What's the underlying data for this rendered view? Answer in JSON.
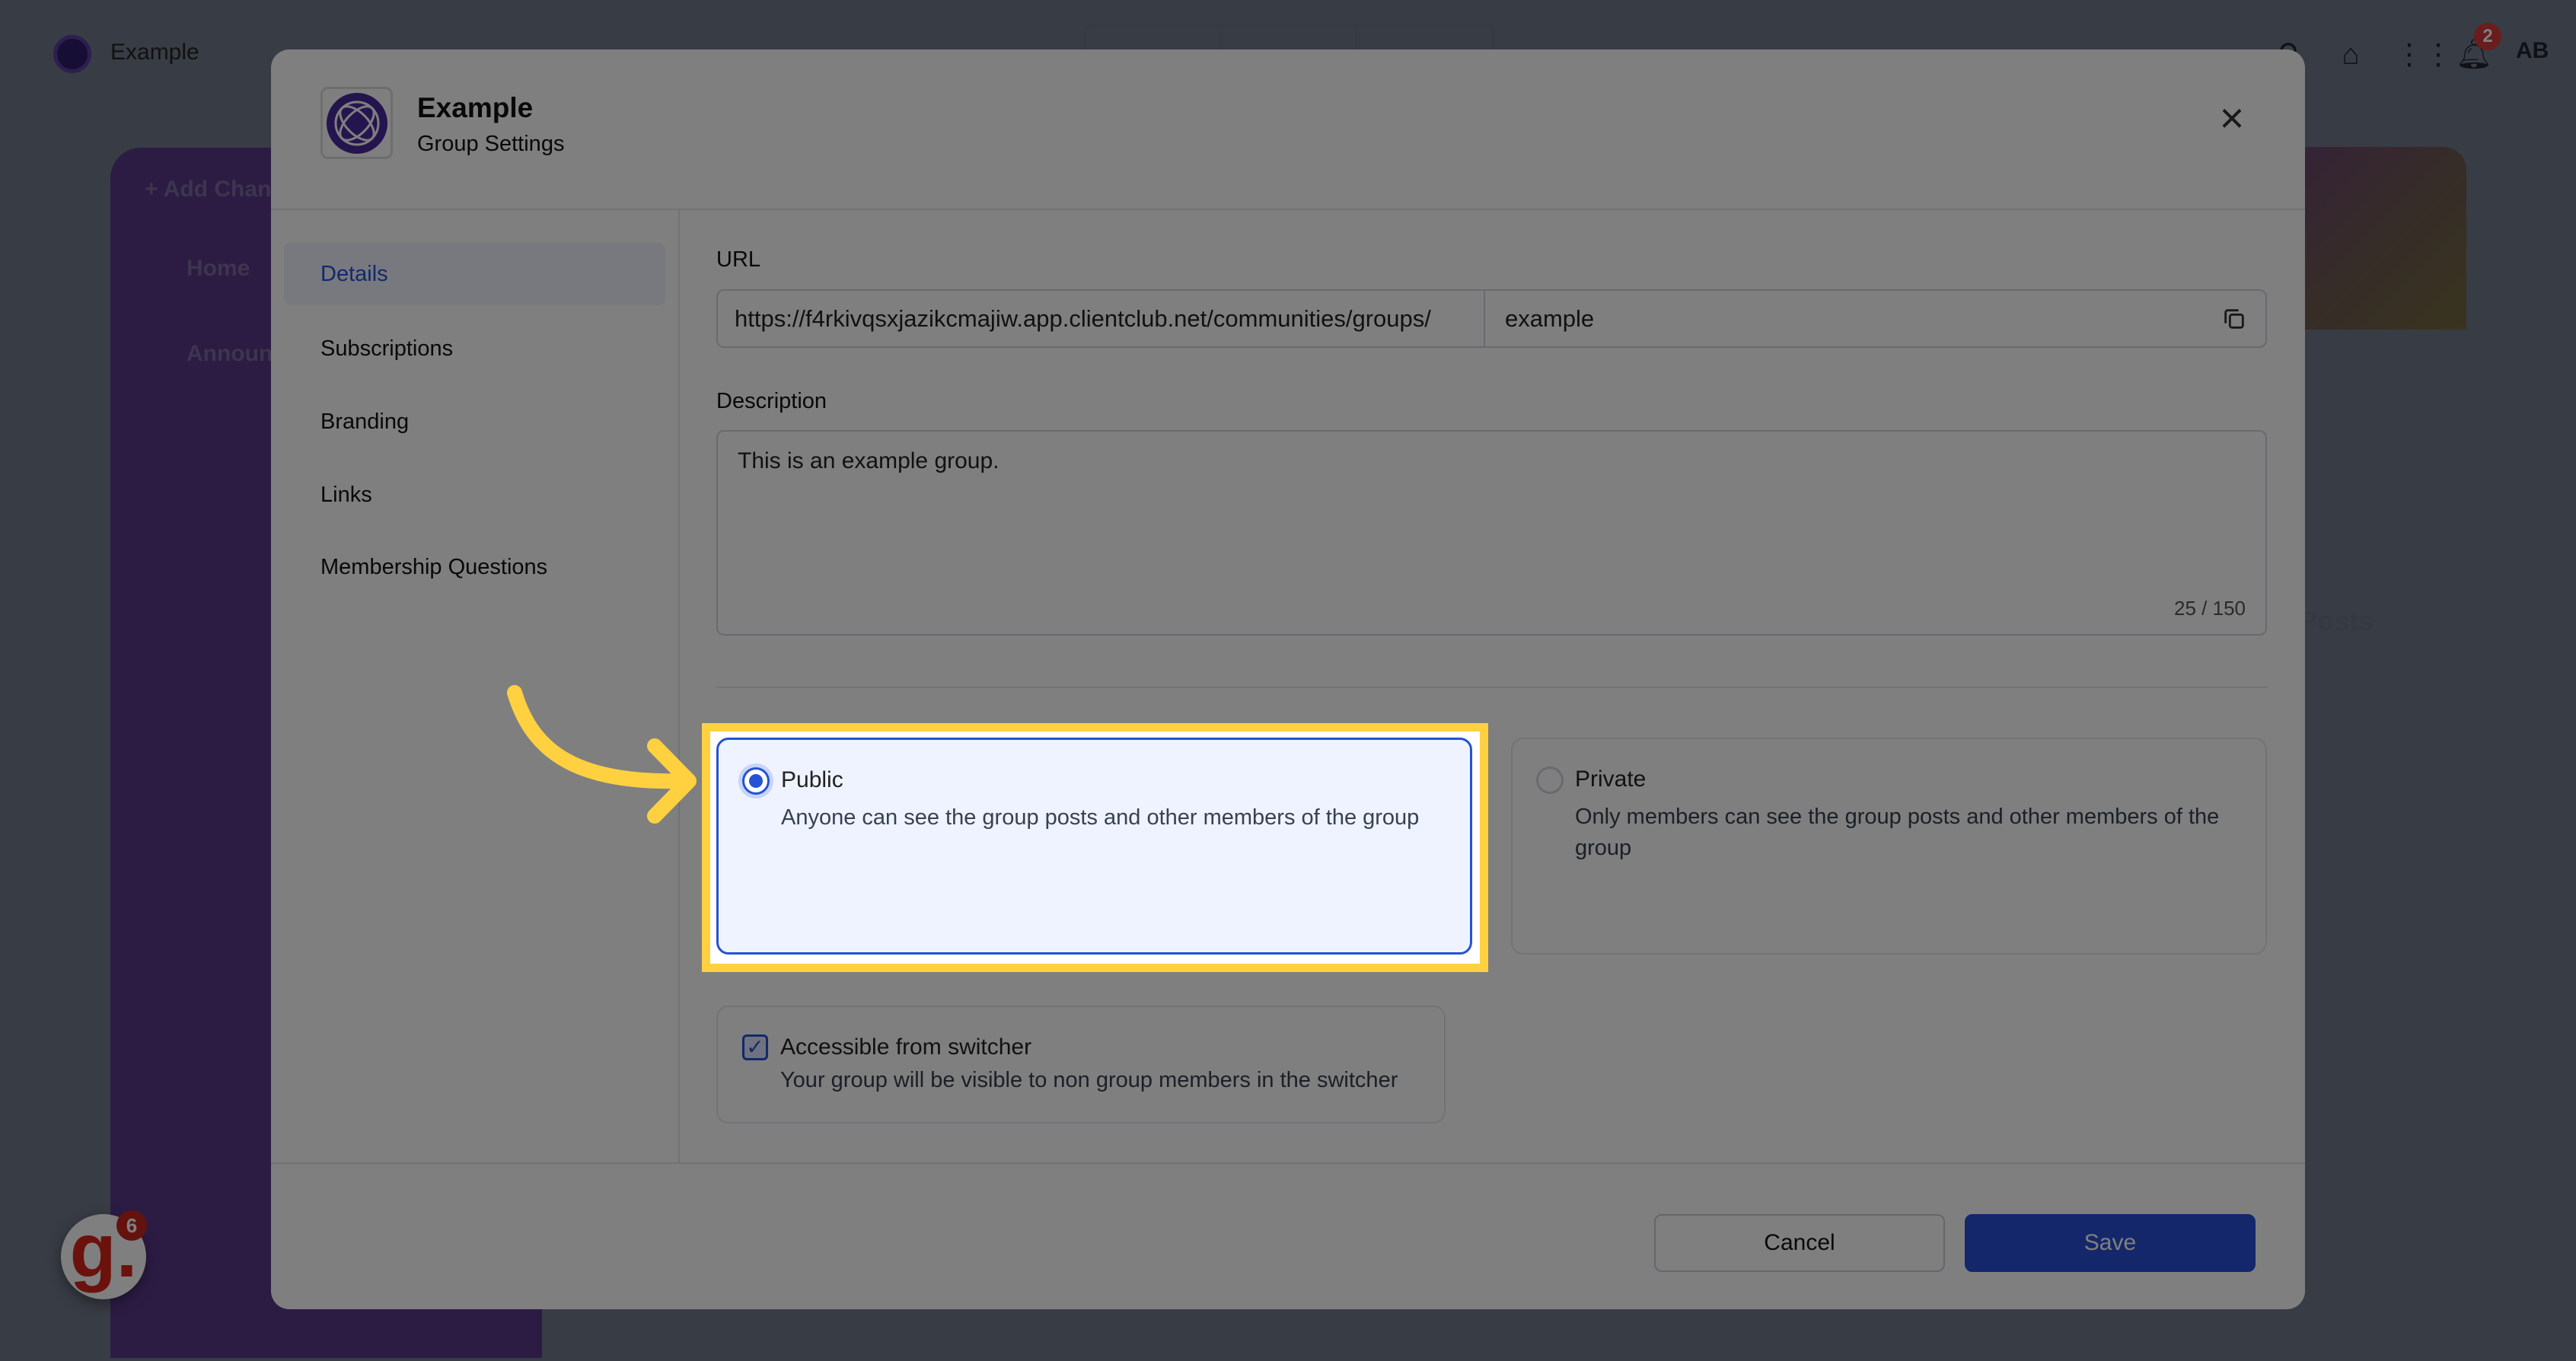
{
  "app": {
    "name": "Example",
    "notification_count": "2",
    "avatar_initials": "AB"
  },
  "sidebar": {
    "items": [
      {
        "label": "+ Add Chan"
      },
      {
        "label": "Home"
      },
      {
        "label": "Announc"
      }
    ]
  },
  "feed": {
    "posts_label": "Posts"
  },
  "widget": {
    "letter": "g.",
    "badge": "6"
  },
  "modal": {
    "title": "Example",
    "subtitle": "Group Settings",
    "nav": [
      {
        "label": "Details",
        "active": true
      },
      {
        "label": "Subscriptions"
      },
      {
        "label": "Branding"
      },
      {
        "label": "Links"
      },
      {
        "label": "Membership Questions"
      }
    ],
    "url": {
      "label": "URL",
      "prefix": "https://f4rkivqsxjazikcmajiw.app.clientclub.net/communities/groups/",
      "slug": "example"
    },
    "description": {
      "label": "Description",
      "value": "This is an example group.",
      "counter": "25 / 150"
    },
    "privacy": [
      {
        "title": "Public",
        "desc": "Anyone can see the group posts and other members of the group",
        "selected": true
      },
      {
        "title": "Private",
        "desc": "Only members can see the group posts and other members of the group",
        "selected": false
      }
    ],
    "switcher": {
      "title": "Accessible from switcher",
      "desc": "Your group will be visible to non group members in the switcher",
      "checked": true
    },
    "cancel": "Cancel",
    "save": "Save"
  },
  "colors": {
    "accent": "#2453d4",
    "highlight": "#ffd140",
    "sidebar": "#583888"
  }
}
